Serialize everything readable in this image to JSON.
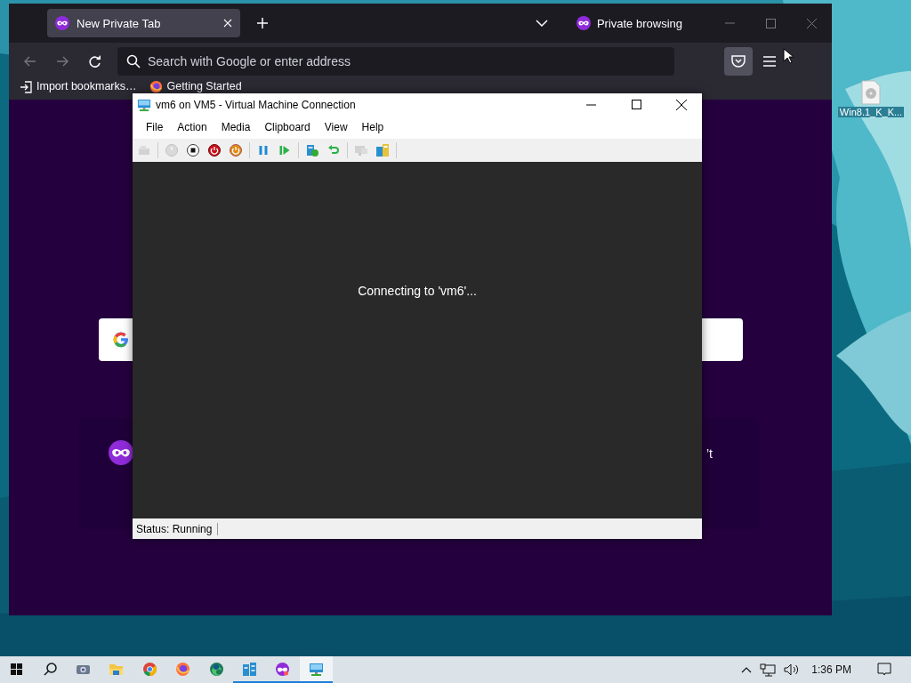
{
  "desktop": {
    "icons": [
      {
        "label": "Win8.1_K_K..."
      }
    ]
  },
  "browser": {
    "tabs": [
      {
        "title": "New Private Tab",
        "selected": true
      }
    ],
    "mode_label": "Private browsing",
    "address_bar": {
      "placeholder": "Search with Google or enter address"
    },
    "bookmarks": [
      {
        "kind": "import",
        "label": "Import bookmarks…"
      },
      {
        "kind": "fox",
        "label": "Getting Started"
      }
    ],
    "card_text_fragment": "’t"
  },
  "vm_window": {
    "title": "vm6 on VM5 - Virtual Machine Connection",
    "menu": [
      "File",
      "Action",
      "Media",
      "Clipboard",
      "View",
      "Help"
    ],
    "toolbar_groups": [
      {
        "buttons": [
          {
            "kind": "keys",
            "disabled": true
          }
        ]
      },
      {
        "buttons": [
          {
            "kind": "start",
            "disabled": true
          },
          {
            "kind": "turn-off",
            "disabled": false
          },
          {
            "kind": "shut-down",
            "disabled": false
          },
          {
            "kind": "save",
            "disabled": false
          }
        ]
      },
      {
        "buttons": [
          {
            "kind": "pause",
            "disabled": false
          },
          {
            "kind": "resume",
            "disabled": false
          }
        ]
      },
      {
        "buttons": [
          {
            "kind": "checkpoint",
            "disabled": false
          },
          {
            "kind": "revert",
            "disabled": false
          }
        ]
      },
      {
        "buttons": [
          {
            "kind": "enhanced",
            "disabled": true
          },
          {
            "kind": "share",
            "disabled": false
          }
        ]
      }
    ],
    "message": "Connecting to 'vm6'...",
    "status": "Status: Running"
  },
  "taskbar": {
    "apps": [
      {
        "kind": "start",
        "running": false,
        "selected": false
      },
      {
        "kind": "search",
        "running": false,
        "selected": false
      },
      {
        "kind": "camera",
        "running": false,
        "selected": false
      },
      {
        "kind": "folder",
        "running": false,
        "selected": false
      },
      {
        "kind": "chrome",
        "running": false,
        "selected": false
      },
      {
        "kind": "fox",
        "running": false,
        "selected": false
      },
      {
        "kind": "edge",
        "running": false,
        "selected": false
      },
      {
        "kind": "manager",
        "running": true,
        "selected": false
      },
      {
        "kind": "private",
        "running": true,
        "selected": false
      },
      {
        "kind": "vm",
        "running": true,
        "selected": true
      }
    ],
    "time": "1:36 PM"
  }
}
